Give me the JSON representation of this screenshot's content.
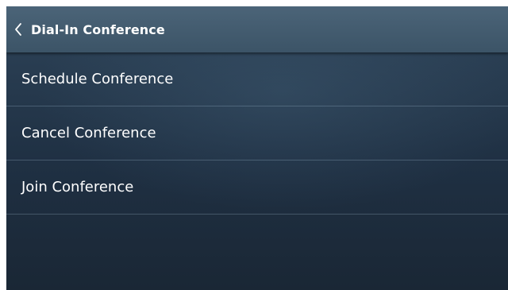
{
  "header": {
    "title": "Dial-In Conference",
    "back_icon": "chevron-left-icon"
  },
  "menu": {
    "items": [
      {
        "label": "Schedule Conference"
      },
      {
        "label": "Cancel Conference"
      },
      {
        "label": "Join Conference"
      }
    ]
  },
  "colors": {
    "header_bg": "#46606f",
    "panel_bg": "#253a4e",
    "text": "#ffffff"
  }
}
